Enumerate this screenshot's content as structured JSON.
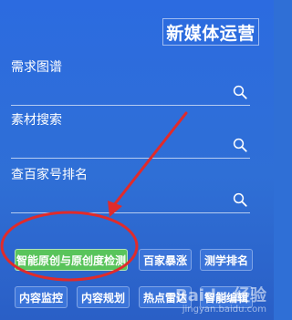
{
  "header": {
    "title": "新媒体运营"
  },
  "fields": [
    {
      "label": "需求图谱"
    },
    {
      "label": "素材搜索"
    },
    {
      "label": "查百家号排名"
    }
  ],
  "buttons_row1": [
    {
      "label": "智能原创与原创度检测"
    },
    {
      "label": "百家暴涨"
    },
    {
      "label": "测学排名"
    }
  ],
  "buttons_row2": [
    {
      "label": "内容监控"
    },
    {
      "label": "内容规划"
    },
    {
      "label": "热点雷达"
    },
    {
      "label": "智能编辑"
    }
  ],
  "watermark": {
    "brand": "Baidu 经验",
    "url": "jingyan.baidu.com"
  },
  "colors": {
    "background": "#2f6fd6",
    "primary_button": "#59c45b",
    "secondary_button": "#3b74d9",
    "annotation_red": "#e02b2b"
  },
  "icons": {
    "search": "search-icon"
  }
}
